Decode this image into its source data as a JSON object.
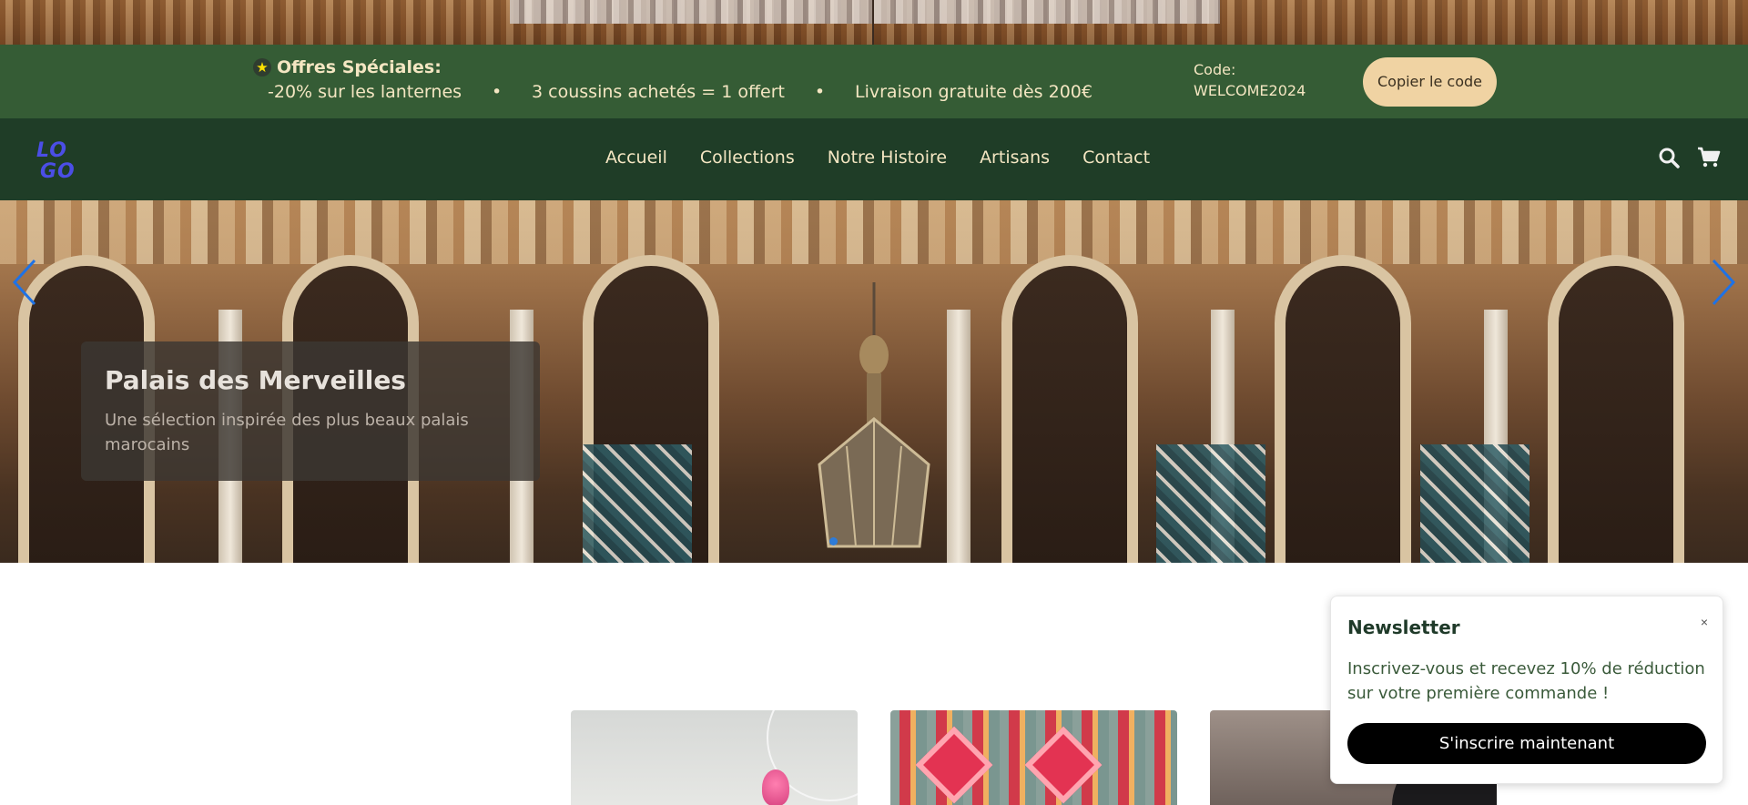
{
  "promo": {
    "title": "Offres Spéciales:",
    "offers": [
      "-20% sur les lanternes",
      "•",
      "3 coussins achetés = 1 offert",
      "•",
      "Livraison gratuite dès 200€"
    ],
    "code_label": "Code: WELCOME2024",
    "copy_button": "Copier le code"
  },
  "header": {
    "logo": "LOGO",
    "nav": [
      "Accueil",
      "Collections",
      "Notre Histoire",
      "Artisans",
      "Contact"
    ]
  },
  "hero": {
    "title": "Palais des Merveilles",
    "subtitle": "Une sélection inspirée des plus beaux palais marocains",
    "active_slide": 1
  },
  "newsletter": {
    "title": "Newsletter",
    "close_label": "×",
    "text": "Inscrivez-vous et recevez 10% de réduction sur votre première commande !",
    "button": "S'inscrire maintenant"
  },
  "colors": {
    "promo_bg": "#355c35",
    "nav_bg": "#1f3d27",
    "accent_cream": "#f0d3a3",
    "nav_text": "#f4e6c2",
    "logo": "#4b4ee6"
  },
  "icons": [
    "star-icon",
    "search-icon",
    "cart-icon",
    "chevron-left-icon",
    "chevron-right-icon"
  ]
}
